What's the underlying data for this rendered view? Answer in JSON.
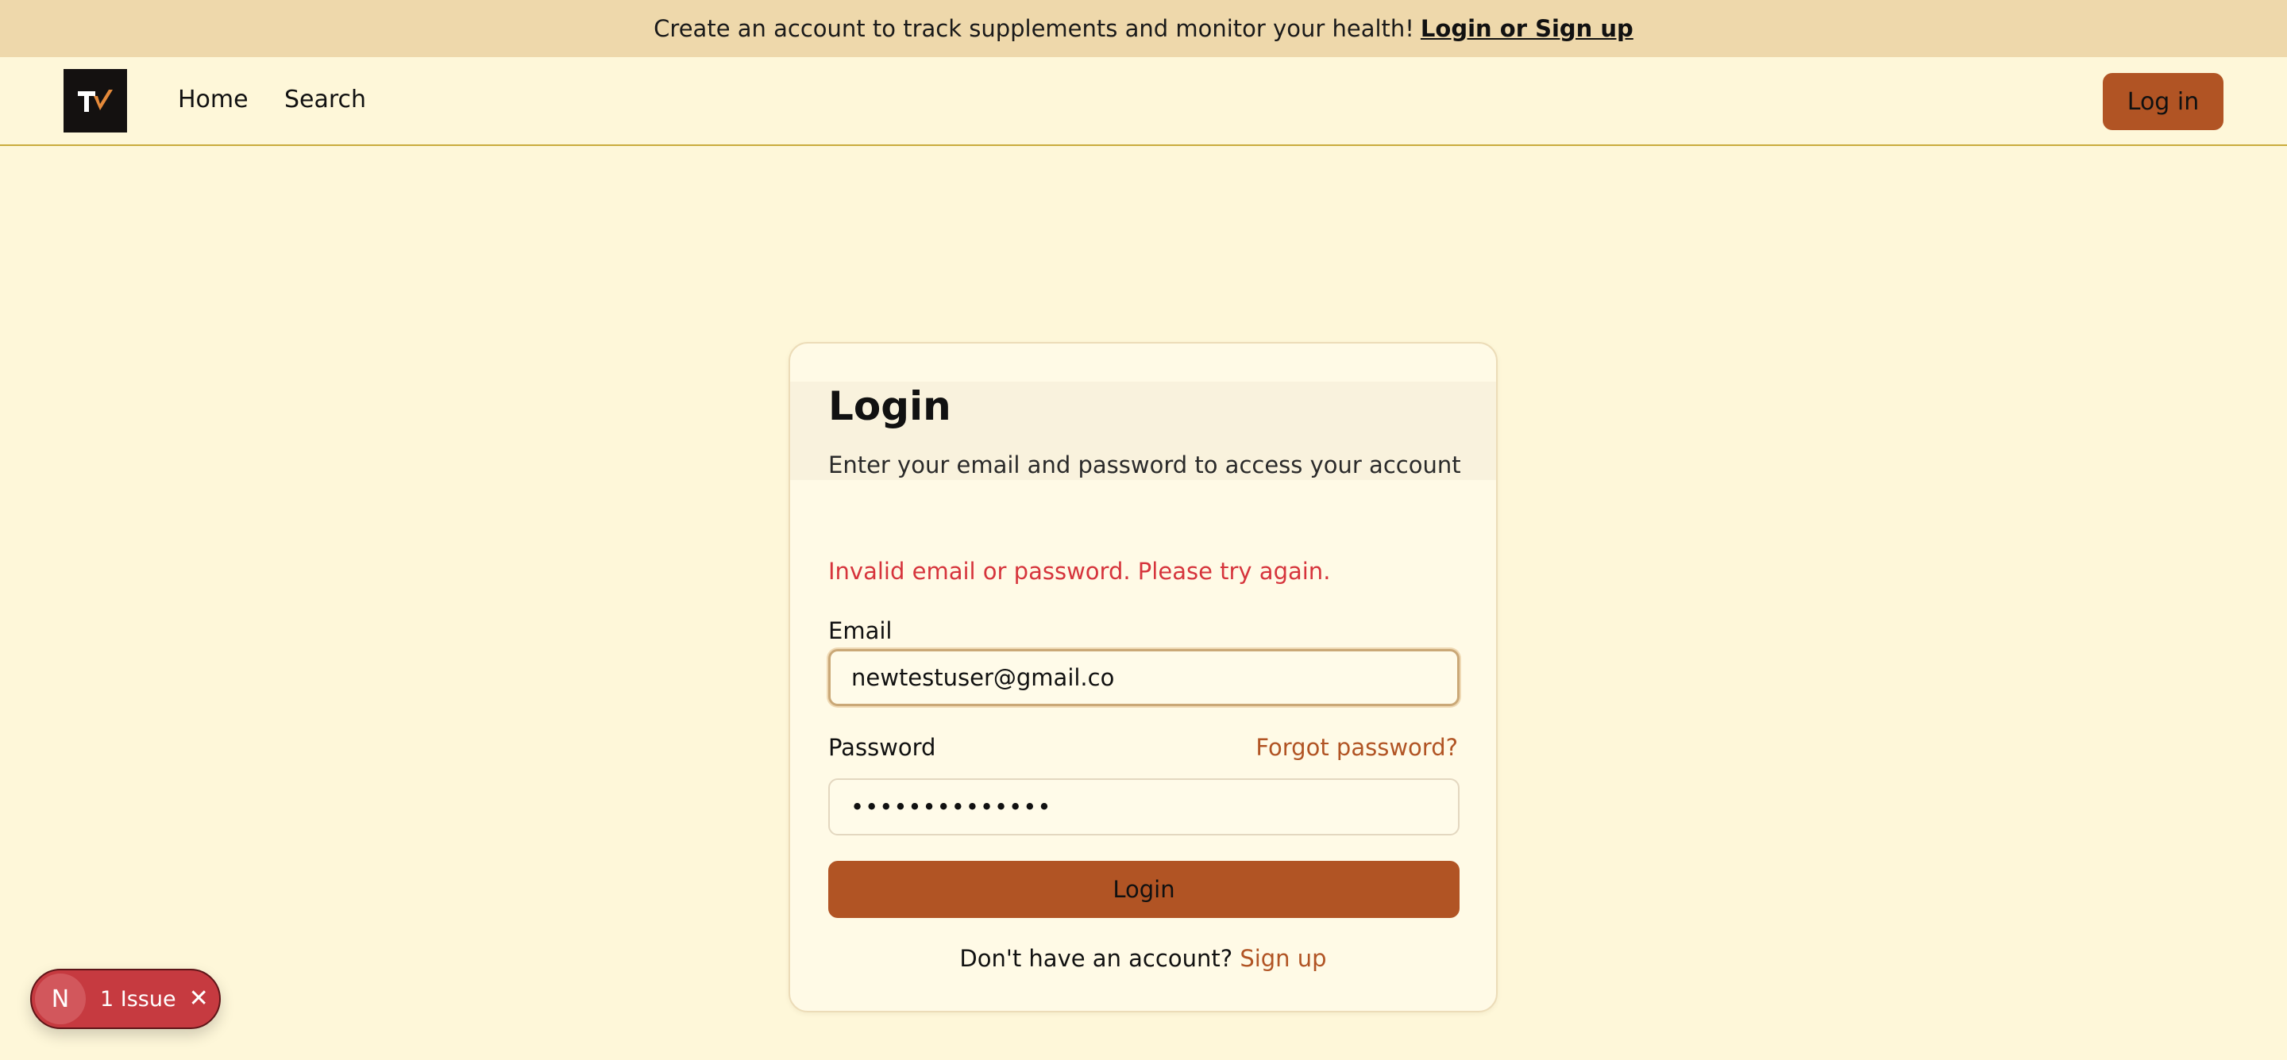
{
  "banner": {
    "message": "Create an account to track supplements and monitor your health!",
    "link_label": "Login or Sign up"
  },
  "nav": {
    "logo_icon": "tv-logo-icon",
    "links": [
      "Home",
      "Search"
    ],
    "login_label": "Log in"
  },
  "card": {
    "title": "Login",
    "description": "Enter your email and password to access your account",
    "error": "Invalid email or password. Please try again.",
    "email_label": "Email",
    "email_value": "newtestuser@gmail.co",
    "password_label": "Password",
    "forgot_label": "Forgot password?",
    "password_value": "••••••••••••••",
    "submit_label": "Login",
    "signup_prompt": "Don't have an account?",
    "signup_link": "Sign up"
  },
  "devtools": {
    "badge_letter": "N",
    "issue_label": "1 Issue",
    "close_icon": "close-icon"
  },
  "colors": {
    "background": "#fef7d9",
    "banner": "#eed8ab",
    "accent": "#b15424",
    "error": "#d6343c",
    "issue_pill": "#c63a40"
  }
}
